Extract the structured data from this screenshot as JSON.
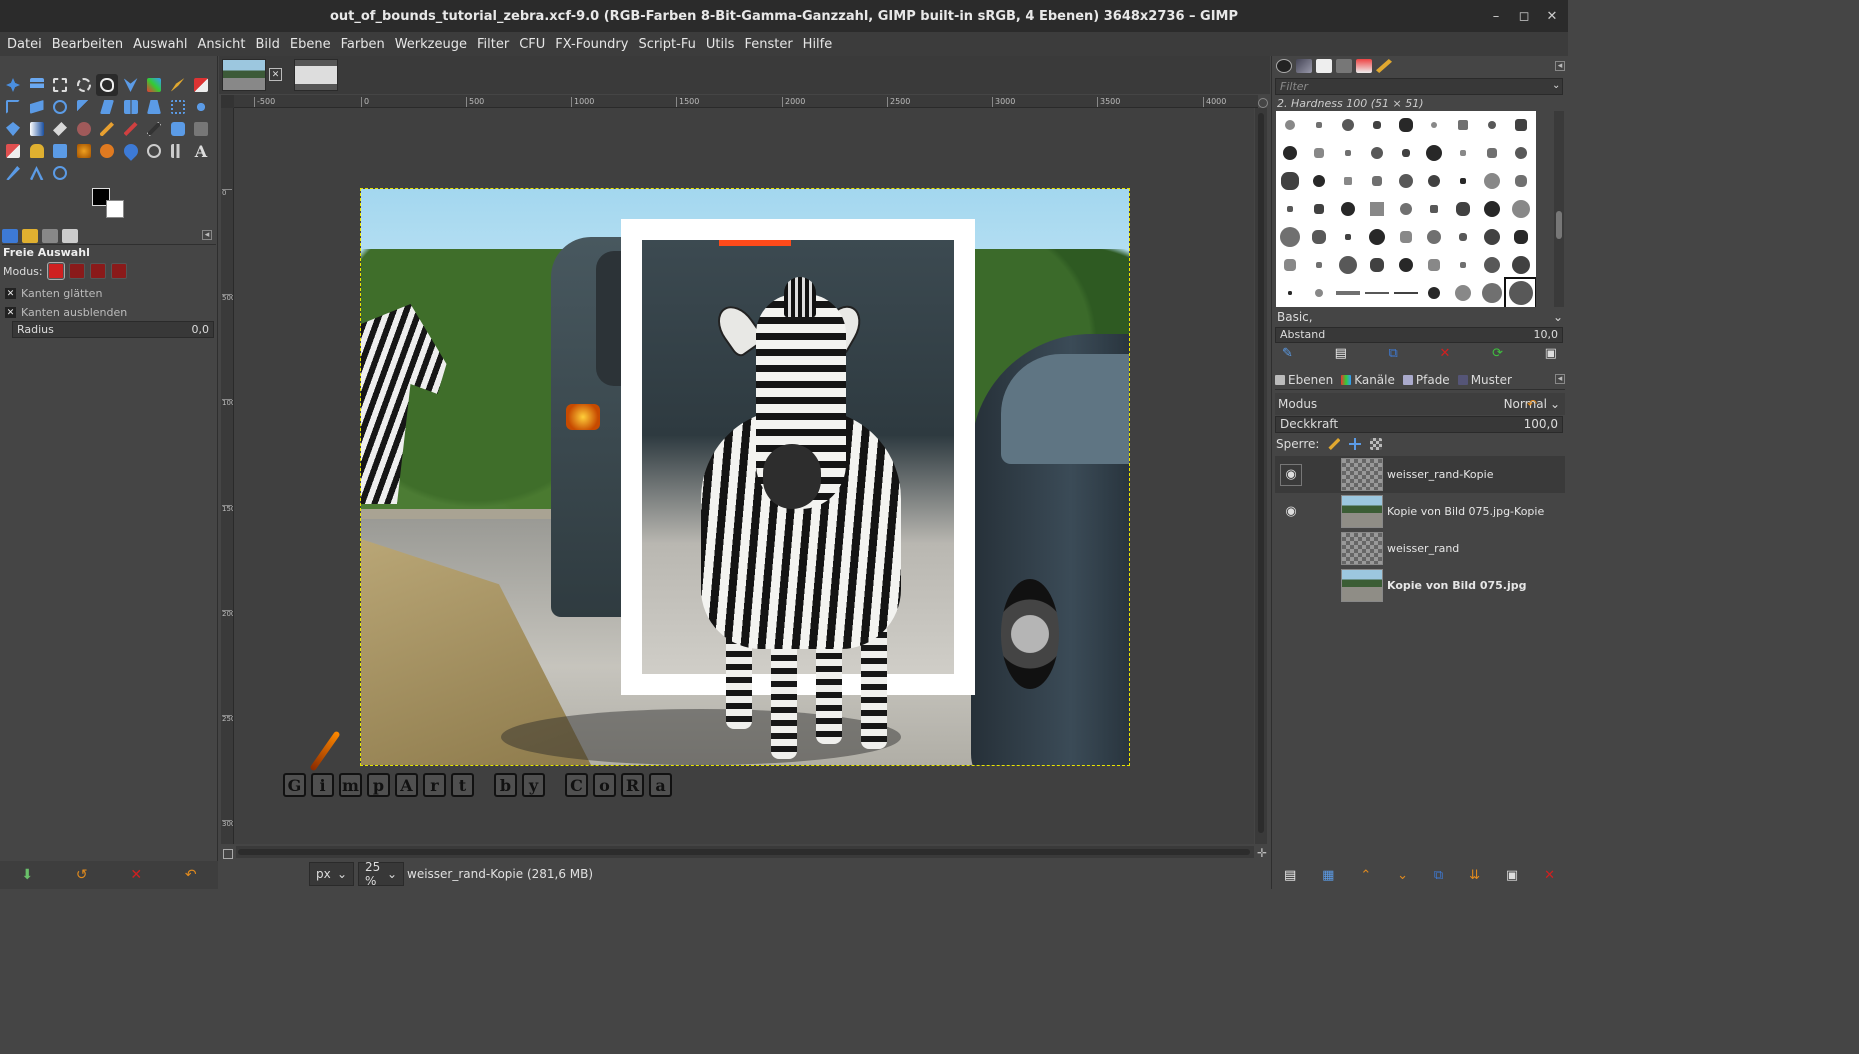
{
  "window": {
    "title": "out_of_bounds_tutorial_zebra.xcf-9.0 (RGB-Farben 8-Bit-Gamma-Ganzzahl, GIMP built-in sRGB, 4 Ebenen) 3648x2736 – GIMP",
    "minimize": "–",
    "maximize": "◻",
    "close": "✕"
  },
  "menu": [
    "Datei",
    "Bearbeiten",
    "Auswahl",
    "Ansicht",
    "Bild",
    "Ebene",
    "Farben",
    "Werkzeuge",
    "Filter",
    "CFU",
    "FX-Foundry",
    "Script-Fu",
    "Utils",
    "Fenster",
    "Hilfe"
  ],
  "tool_options": {
    "title": "Freie Auswahl",
    "mode_label": "Modus:",
    "antialias": "Kanten glätten",
    "antialias_checked": "✕",
    "feather": "Kanten ausblenden",
    "feather_checked": "✕",
    "radius_label": "Radius",
    "radius_value": "0,0"
  },
  "colors": {
    "foreground": "#000000",
    "background": "#ffffff"
  },
  "image_tabs": {
    "close_icon": "✕"
  },
  "ruler_h": [
    "-500",
    "0",
    "500",
    "1000",
    "1500",
    "2000",
    "2500",
    "3000",
    "3500",
    "4000"
  ],
  "ruler_v": [
    "0",
    "500",
    "1000",
    "1500",
    "2000",
    "2500",
    "3000"
  ],
  "watermark": [
    "G",
    "i",
    "m",
    "p",
    "A",
    "r",
    "t",
    "",
    "b",
    "y",
    "",
    "C",
    "o",
    "R",
    "a"
  ],
  "status": {
    "unit": "px",
    "zoom": "25 %",
    "text": "weisser_rand-Kopie (281,6 MB)"
  },
  "brushes": {
    "filter_placeholder": "Filter",
    "current": "2. Hardness 100 (51 × 51)",
    "preset": "Basic,",
    "spacing_label": "Abstand",
    "spacing_value": "10,0"
  },
  "layers_panel": {
    "tabs": [
      "Ebenen",
      "Kanäle",
      "Pfade",
      "Muster"
    ],
    "mode_label": "Modus",
    "mode_value": "Normal",
    "opacity_label": "Deckkraft",
    "opacity_value": "100,0",
    "lock_label": "Sperre:",
    "layers": [
      {
        "name": "weisser_rand-Kopie",
        "visible": true,
        "selected": true,
        "thumb": "transparent",
        "bold": false
      },
      {
        "name": "Kopie von Bild 075.jpg-Kopie",
        "visible": true,
        "selected": false,
        "thumb": "image",
        "bold": false
      },
      {
        "name": "weisser_rand",
        "visible": false,
        "selected": false,
        "thumb": "transparent",
        "bold": false
      },
      {
        "name": "Kopie von Bild 075.jpg",
        "visible": false,
        "selected": false,
        "thumb": "image",
        "bold": true
      }
    ]
  },
  "accent": {
    "selection": "#e6e600",
    "danger": "#cf2020",
    "ok": "#3fbf3f",
    "blue": "#3d7ad6",
    "orange": "#e08a1e"
  }
}
